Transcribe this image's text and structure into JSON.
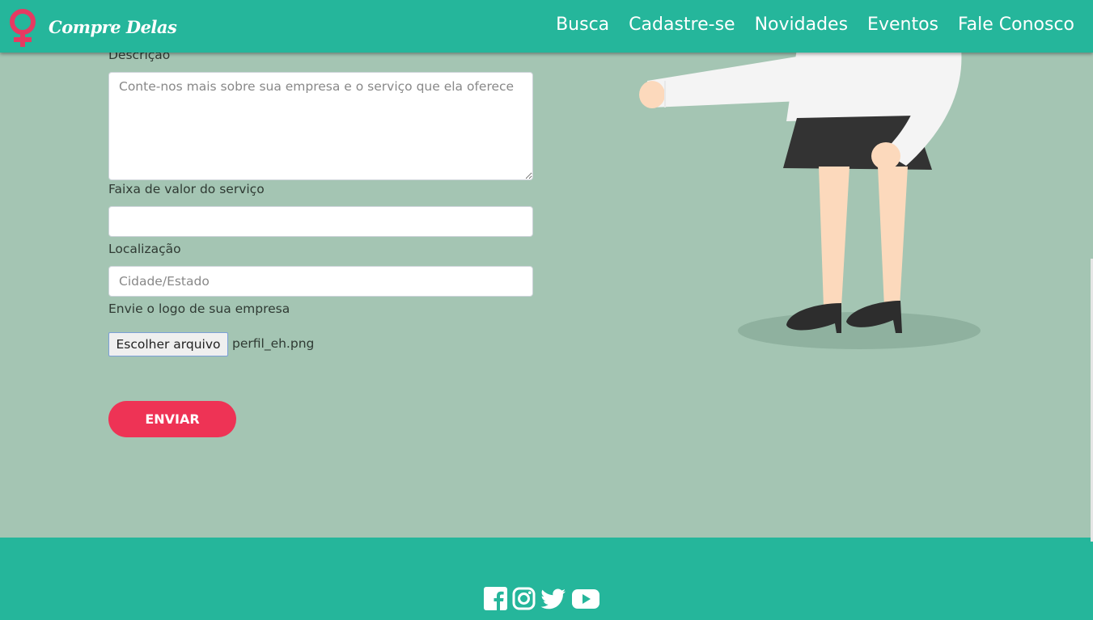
{
  "brand": {
    "name": "Compre Delas",
    "icon": "female-symbol-icon"
  },
  "nav": {
    "items": [
      "Busca",
      "Cadastre-se",
      "Novidades",
      "Eventos",
      "Fale Conosco"
    ]
  },
  "form": {
    "description_label": "Descrição",
    "description_placeholder": "Conte-nos mais sobre sua empresa e o serviço que ela oferece",
    "price_label": "Faixa de valor do serviço",
    "price_value": "",
    "location_label": "Localização",
    "location_placeholder": "Cidade/Estado",
    "logo_label": "Envie o logo de sua empresa",
    "file_button": "Escolher arquivo",
    "file_name": "perfil_eh.png",
    "submit": "ENVIAR"
  },
  "footer": {
    "social": [
      "facebook-icon",
      "instagram-icon",
      "twitter-icon",
      "youtube-icon"
    ]
  },
  "colors": {
    "header": "#25b69b",
    "background": "#a4c5b3",
    "accent": "#ee3355",
    "brand_icon": "#e63a62"
  }
}
